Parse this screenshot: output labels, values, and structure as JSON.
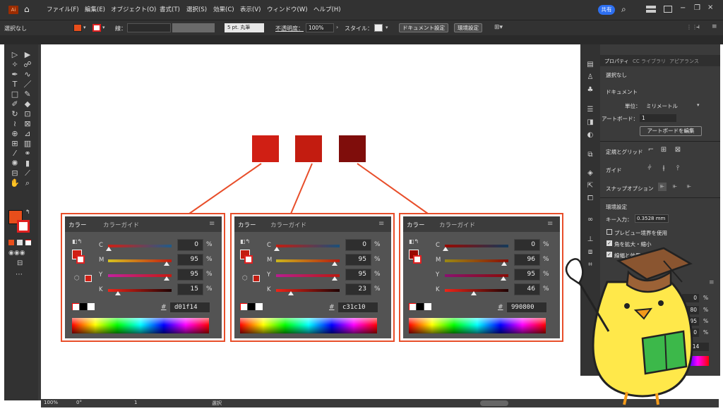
{
  "menubar": {
    "app_logo": "Ai",
    "items": [
      "ファイル(F)",
      "編集(E)",
      "オブジェクト(O)",
      "書式(T)",
      "選択(S)",
      "効果(C)",
      "表示(V)",
      "ウィンドウ(W)",
      "ヘルプ(H)"
    ],
    "share_label": "共有"
  },
  "options": {
    "selection_label": "選択なし",
    "stroke_label": "線：",
    "brush_label": "5 pt. 丸筆",
    "opacity_label": "不透明度：",
    "opacity_value": "100%",
    "style_label": "スタイル：",
    "doc_settings": "ドキュメント設定",
    "prefs": "環境設定"
  },
  "swatches": [
    {
      "color": "#d01f14"
    },
    {
      "color": "#c31c10"
    },
    {
      "color": "#990800"
    }
  ],
  "color_panels": [
    {
      "tab_color": "カラー",
      "tab_guide": "カラーガイド",
      "c": "0",
      "m": "95",
      "y": "95",
      "k": "15",
      "hex": "d01f14",
      "fill": "#d01f14",
      "pct": "%",
      "hash": "#"
    },
    {
      "tab_color": "カラー",
      "tab_guide": "カラーガイド",
      "c": "0",
      "m": "95",
      "y": "95",
      "k": "23",
      "hex": "c31c10",
      "fill": "#c31c10",
      "pct": "%",
      "hash": "#"
    },
    {
      "tab_color": "カラー",
      "tab_guide": "カラーガイド",
      "c": "0",
      "m": "96",
      "y": "95",
      "k": "46",
      "hex": "990800",
      "fill": "#990800",
      "pct": "%",
      "hash": "#"
    }
  ],
  "cmyk_labels": [
    "C",
    "M",
    "Y",
    "K"
  ],
  "properties": {
    "tabs": [
      "プロパティ",
      "CC ライブラリ",
      "アピアランス"
    ],
    "selection": "選択なし",
    "document_heading": "ドキュメント",
    "units_label": "単位：",
    "units_value": "ミリメートル",
    "artboard_label": "アートボード：",
    "artboard_value": "1",
    "edit_artboard": "アートボードを編集",
    "rulers_grid": "定規とグリッド",
    "guides": "ガイド",
    "snap": "スナップオプション",
    "prefs_heading": "環境設定",
    "key_input_label": "キー入力：",
    "key_input_value": "0.3528 mm",
    "preview_bounds": "プレビュー境界を使用",
    "scale_corners": "角を拡大・縮小",
    "scale_strokes": "線幅と効果も拡大・縮小"
  },
  "panel2": {
    "values": [
      "0",
      "80",
      "95",
      "0"
    ],
    "pct": "%",
    "hex_partial": "ea5514"
  },
  "status": {
    "zoom": "100%",
    "rotation": "0°",
    "artboard": "1",
    "tool": "選択"
  }
}
